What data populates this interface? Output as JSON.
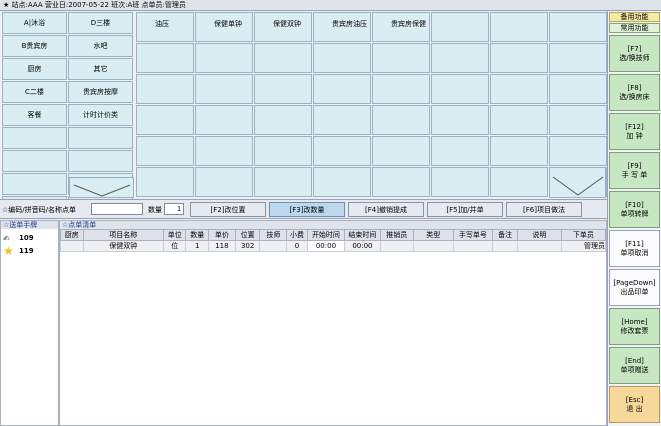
{
  "titlebar": {
    "star": "★",
    "text": "站点:AAA 营业日:2007-05-22 班次:A班 点单员:管理员"
  },
  "categories": [
    "A|沐浴",
    "D三楼",
    "B贵宾房",
    "水吧",
    "厨房",
    "其它",
    "C二楼",
    "贵宾房按摩",
    "客餐",
    "计时计价类",
    "",
    "",
    "",
    "",
    "",
    "",
    "",
    ""
  ],
  "services": [
    "油压",
    "保健单钟",
    "保健双钟",
    "贵宾房油压",
    "贵宾房保健",
    "",
    "",
    "",
    "",
    "",
    "",
    "",
    "",
    "",
    "",
    "",
    "",
    "",
    "",
    "",
    "",
    "",
    "",
    "",
    "",
    "",
    "",
    "",
    "",
    "",
    "",
    "",
    "",
    "",
    "",
    "",
    "",
    "",
    "",
    "",
    "",
    "",
    "",
    "",
    "",
    "",
    "",
    "",
    ""
  ],
  "search": {
    "label": "☆编码/拼音码/名称点单",
    "value": "",
    "qty_label": "数量",
    "qty_value": "1"
  },
  "actions": [
    {
      "label": "[F2]改位置",
      "active": false
    },
    {
      "label": "[F3]改数量",
      "active": true
    },
    {
      "label": "[F4]撤销提成",
      "active": false
    },
    {
      "label": "[F5]加/并单",
      "active": false
    },
    {
      "label": "[F6]项目做法",
      "active": false
    }
  ],
  "hand_panel": {
    "title": "☆送单手牌",
    "items": [
      {
        "icon": "hand-card-icon",
        "number": "109"
      },
      {
        "icon": "star-icon",
        "number": "119"
      }
    ]
  },
  "order_panel": {
    "title": "☆点单清单",
    "columns": [
      "厨房",
      "项目名称",
      "单位",
      "数量",
      "单价",
      "位置",
      "技师",
      "小费",
      "开始时间",
      "结束时间",
      "推销员",
      "类型",
      "手写单号",
      "备注",
      "说明",
      "下单员"
    ],
    "rows": [
      [
        "",
        "保健双钟",
        "位",
        "1",
        "118",
        "302",
        "",
        "0",
        "00:00",
        "00:00",
        "",
        "",
        "",
        "",
        "",
        "管理员"
      ]
    ]
  },
  "sidebar": {
    "tab1": "备用功能",
    "tab2": "常用功能",
    "buttons": [
      {
        "key": "[F7]",
        "label": "选/换技师",
        "style": "green"
      },
      {
        "key": "[F8]",
        "label": "选/换房床",
        "style": "green"
      },
      {
        "key": "[F12]",
        "label": "加 钟",
        "style": "green"
      },
      {
        "key": "[F9]",
        "label": "手 写 单",
        "style": "green"
      },
      {
        "key": "[F10]",
        "label": "单项转牌",
        "style": "green"
      },
      {
        "key": "[F11]",
        "label": "单项取消",
        "style": "white"
      },
      {
        "key": "[PageDown]",
        "label": "出品印单",
        "style": "white"
      },
      {
        "key": "[Home]",
        "label": "修改套票",
        "style": "green"
      },
      {
        "key": "[End]",
        "label": "单项赠送",
        "style": "green"
      },
      {
        "key": "[Esc]",
        "label": "退 出",
        "style": "exit"
      }
    ]
  }
}
